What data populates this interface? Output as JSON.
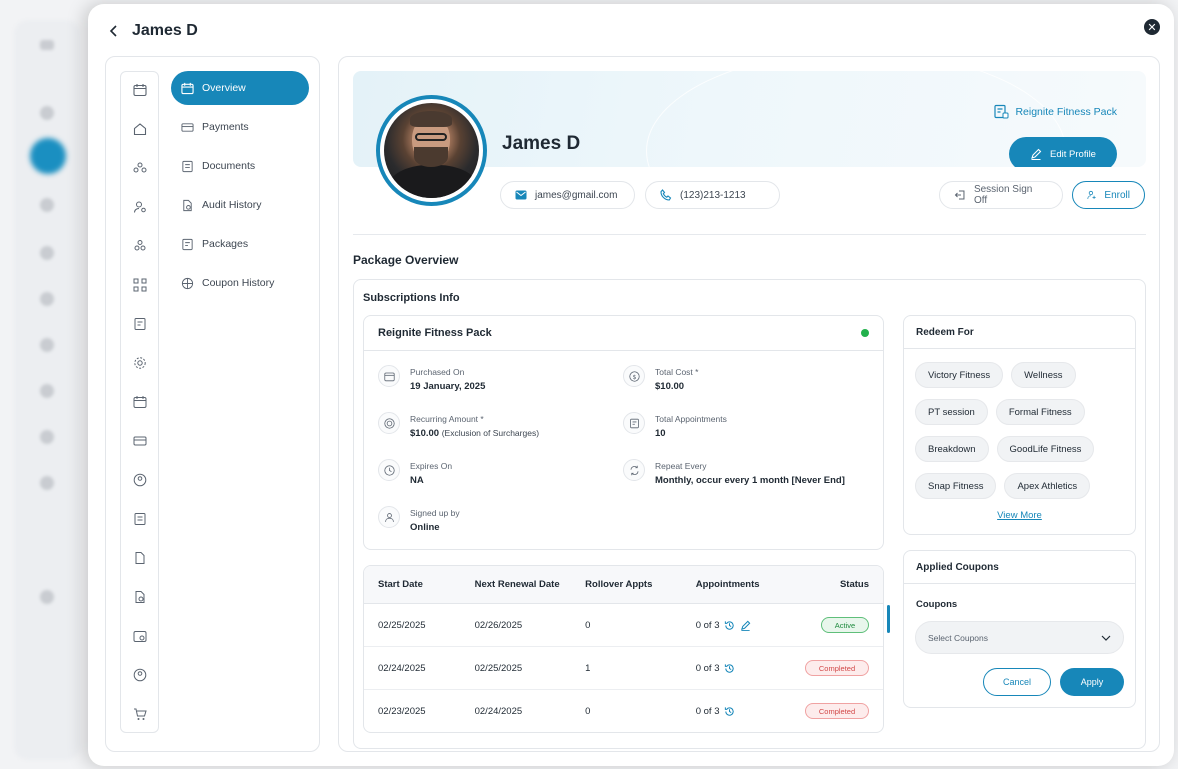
{
  "header": {
    "title": "James D"
  },
  "nav": {
    "items": [
      {
        "label": "Overview",
        "icon": "calendar-check-icon"
      },
      {
        "label": "Payments",
        "icon": "card-icon"
      },
      {
        "label": "Documents",
        "icon": "document-icon"
      },
      {
        "label": "Audit History",
        "icon": "audit-icon"
      },
      {
        "label": "Packages",
        "icon": "package-icon"
      },
      {
        "label": "Coupon History",
        "icon": "coupon-icon"
      }
    ]
  },
  "profile": {
    "name": "James D",
    "email": "james@gmail.com",
    "phone": "(123)213-1213",
    "package_link": "Reignite Fitness Pack",
    "edit_label": "Edit Profile",
    "session_label": "Session Sign Off",
    "enroll_label": "Enroll"
  },
  "package_overview": {
    "title": "Package Overview",
    "subscriptions_title": "Subscriptions Info",
    "pack_name": "Reignite Fitness Pack",
    "purchased_on_label": "Purchased On",
    "purchased_on": "19 January, 2025",
    "total_cost_label": "Total Cost *",
    "total_cost": "$10.00",
    "recurring_label": "Recurring Amount *",
    "recurring_value": "$10.00",
    "recurring_note": "(Exclusion of Surcharges)",
    "total_appts_label": "Total Appointments",
    "total_appts": "10",
    "expires_label": "Expires On",
    "expires_value": "NA",
    "repeat_label": "Repeat Every",
    "repeat_value": "Monthly, occur every 1 month [Never End]",
    "signed_label": "Signed up by",
    "signed_value": "Online"
  },
  "table": {
    "headers": [
      "Start Date",
      "Next Renewal Date",
      "Rollover Appts",
      "Appointments",
      "Status"
    ],
    "rows": [
      {
        "start": "02/25/2025",
        "renewal": "02/26/2025",
        "rollover": "0",
        "appointments": "0 of 3",
        "status": "Active"
      },
      {
        "start": "02/24/2025",
        "renewal": "02/25/2025",
        "rollover": "1",
        "appointments": "0 of 3",
        "status": "Completed"
      },
      {
        "start": "02/23/2025",
        "renewal": "02/24/2025",
        "rollover": "0",
        "appointments": "0 of 3",
        "status": "Completed"
      }
    ]
  },
  "redeem": {
    "title": "Redeem For",
    "tags": [
      "Victory Fitness",
      "Wellness",
      "PT session",
      "Formal Fitness",
      "Breakdown",
      "GoodLife Fitness",
      "Snap Fitness",
      "Apex Athletics"
    ],
    "view_more": "View More"
  },
  "coupons": {
    "title": "Applied Coupons",
    "label": "Coupons",
    "placeholder": "Select Coupons",
    "cancel": "Cancel",
    "apply": "Apply"
  },
  "colors": {
    "accent": "#1787b9",
    "active_green": "#22b14c",
    "completed_red": "#d24848"
  }
}
